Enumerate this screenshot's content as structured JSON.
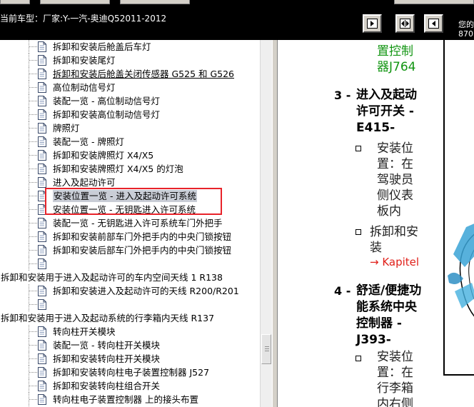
{
  "header": {
    "vehicle_model": "当前车型：厂家:Y-一汽-奥迪Q52011-2012",
    "corner_top": "您的",
    "corner_bottom": "870",
    "nav_buttons": [
      "first-page-icon",
      "expand-icon",
      "last-page-icon"
    ]
  },
  "tree": {
    "items": [
      {
        "label": "拆卸和安装后舱盖后车灯",
        "level": 2
      },
      {
        "label": "拆卸和安装尾灯",
        "level": 2
      },
      {
        "label": "拆卸和安装后舱盖关闭传感器 G525 和 G526",
        "level": 2,
        "link": true
      },
      {
        "label": "高位制动信号灯",
        "level": 2
      },
      {
        "label": "装配一览 - 高位制动信号灯",
        "level": 2
      },
      {
        "label": "拆卸和安装高位制动信号灯",
        "level": 2
      },
      {
        "label": "牌照灯",
        "level": 2
      },
      {
        "label": "装配一览 - 牌照灯",
        "level": 2
      },
      {
        "label": "拆卸和安装牌照灯 X4/X5",
        "level": 2
      },
      {
        "label": "拆卸和安装牌照灯 X4/X5 的灯泡",
        "level": 2
      },
      {
        "label": "进入及起动许可",
        "level": 2
      },
      {
        "label": "安装位置一览 - 进入及起动许可系统",
        "level": 2,
        "selected": true
      },
      {
        "label": "安装位置一览 - 无钥匙进入许可系统",
        "level": 2
      },
      {
        "label": "装配一览 - 无钥匙进入许可系统车门外把手",
        "level": 2
      },
      {
        "label": "拆卸和安装前部车门外把手内的中央门锁按钮",
        "level": 2
      },
      {
        "label": "拆卸和安装后部车门外把手内的中央门锁按钮",
        "level": 2
      },
      {
        "label": "",
        "level": 2
      },
      {
        "label": "拆卸和安装用于进入及起动许可的车内空间天线 1 R138",
        "level": 0
      },
      {
        "label": "拆卸和安装进入及起动许可的天线 R200/R201",
        "level": 2
      },
      {
        "label": "",
        "level": 2
      },
      {
        "label": "拆卸和安装用于进入及起动系统的行李箱内天线 R137",
        "level": 0
      },
      {
        "label": "转向柱开关模块",
        "level": 2
      },
      {
        "label": "装配一览 - 转向柱开关模块",
        "level": 2
      },
      {
        "label": "拆卸和安装转向柱开关模块",
        "level": 2
      },
      {
        "label": "拆卸和安装转向柱电子装置控制器 J527",
        "level": 2
      },
      {
        "label": "拆卸和安装转向柱组合开关",
        "level": 2
      },
      {
        "label": "转向柱电子装置控制器 上的接头布置",
        "level": 2
      }
    ]
  },
  "content": {
    "prev_item_line1": "置控制",
    "prev_item_line2": "器J764",
    "item3": {
      "number": "3 -",
      "title_lines": [
        "进入及起动",
        "许可开关 -",
        "E415-"
      ],
      "sub1_lines": [
        "安装位",
        "置：在",
        "驾驶员",
        "侧仪表",
        "板内"
      ],
      "sub2_lines": [
        "拆卸和安",
        "装"
      ],
      "link": "→ Kapitel"
    },
    "item4": {
      "number": "4 -",
      "title_lines": [
        "舒适/便捷功",
        "能系统中央",
        "控制器 -",
        "J393-"
      ],
      "sub1_lines": [
        "安装位",
        "置：在",
        "行李箱",
        "内右侧"
      ]
    }
  },
  "colors": {
    "highlight_border": "#e8232a",
    "green_text": "#129512",
    "link_red": "#e0201a",
    "selection_bg": "#c9cdd6"
  }
}
